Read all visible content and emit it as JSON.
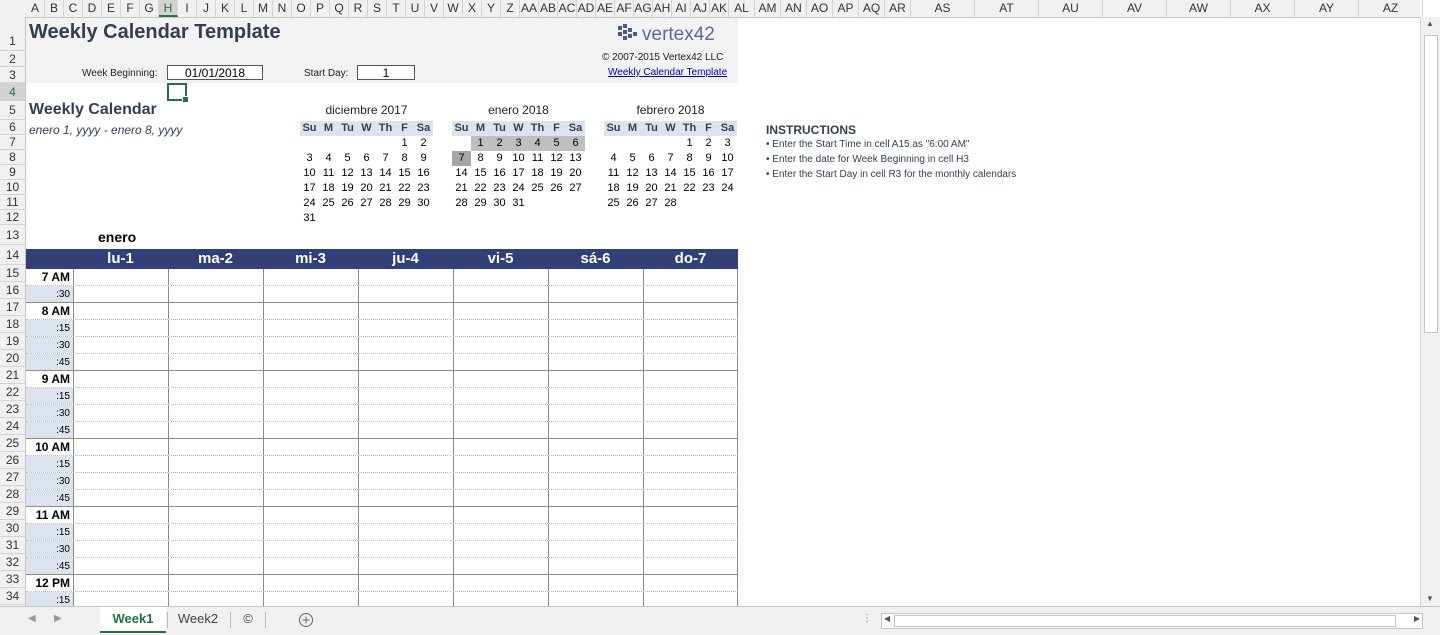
{
  "columns": [
    "A",
    "B",
    "C",
    "D",
    "E",
    "F",
    "G",
    "H",
    "I",
    "J",
    "K",
    "L",
    "M",
    "N",
    "O",
    "P",
    "Q",
    "R",
    "S",
    "T",
    "U",
    "V",
    "W",
    "X",
    "Y",
    "Z",
    "AA",
    "AB",
    "AC",
    "AD",
    "AE",
    "AF",
    "AG",
    "AH",
    "AI",
    "AJ",
    "AK",
    "AL",
    "AM",
    "AN",
    "AO",
    "AP",
    "AQ",
    "AR",
    "AS",
    "AT",
    "AU",
    "AV",
    "AW",
    "AX",
    "AY",
    "AZ"
  ],
  "selected_column": "H",
  "rows": [
    "1",
    "2",
    "3",
    "4",
    "5",
    "6",
    "7",
    "8",
    "9",
    "10",
    "11",
    "12",
    "13",
    "14",
    "15",
    "16",
    "17",
    "18",
    "19",
    "20",
    "21",
    "22",
    "23",
    "24",
    "25",
    "26",
    "27",
    "28",
    "29",
    "30",
    "31",
    "32",
    "33",
    "34"
  ],
  "selected_row": "4",
  "header": {
    "title": "Weekly Calendar Template",
    "logo_text": "vertex42",
    "copyright": "© 2007-2015 Vertex42 LLC",
    "link": "Weekly Calendar Template",
    "week_beginning_label": "Week Beginning:",
    "week_beginning_value": "01/01/2018",
    "start_day_label": "Start Day:",
    "start_day_value": "1"
  },
  "calendar": {
    "heading": "Weekly Calendar",
    "range": "enero 1, yyyy - enero 8, yyyy",
    "month_label": "enero"
  },
  "mini_calendars": [
    {
      "title": "diciembre 2017",
      "days": [
        "Su",
        "M",
        "Tu",
        "W",
        "Th",
        "F",
        "Sa"
      ],
      "weeks": [
        [
          "",
          "",
          "",
          "",
          "",
          "1",
          "2"
        ],
        [
          "3",
          "4",
          "5",
          "6",
          "7",
          "8",
          "9"
        ],
        [
          "10",
          "11",
          "12",
          "13",
          "14",
          "15",
          "16"
        ],
        [
          "17",
          "18",
          "19",
          "20",
          "21",
          "22",
          "23"
        ],
        [
          "24",
          "25",
          "26",
          "27",
          "28",
          "29",
          "30"
        ],
        [
          "31",
          "",
          "",
          "",
          "",
          "",
          ""
        ]
      ]
    },
    {
      "title": "enero 2018",
      "days": [
        "Su",
        "M",
        "Tu",
        "W",
        "Th",
        "F",
        "Sa"
      ],
      "weeks": [
        [
          "",
          "1",
          "2",
          "3",
          "4",
          "5",
          "6"
        ],
        [
          "7",
          "8",
          "9",
          "10",
          "11",
          "12",
          "13"
        ],
        [
          "14",
          "15",
          "16",
          "17",
          "18",
          "19",
          "20"
        ],
        [
          "21",
          "22",
          "23",
          "24",
          "25",
          "26",
          "27"
        ],
        [
          "28",
          "29",
          "30",
          "31",
          "",
          "",
          ""
        ]
      ]
    },
    {
      "title": "febrero 2018",
      "days": [
        "Su",
        "M",
        "Tu",
        "W",
        "Th",
        "F",
        "Sa"
      ],
      "weeks": [
        [
          "",
          "",
          "",
          "",
          "1",
          "2",
          "3"
        ],
        [
          "4",
          "5",
          "6",
          "7",
          "8",
          "9",
          "10"
        ],
        [
          "11",
          "12",
          "13",
          "14",
          "15",
          "16",
          "17"
        ],
        [
          "18",
          "19",
          "20",
          "21",
          "22",
          "23",
          "24"
        ],
        [
          "25",
          "26",
          "27",
          "28",
          "",
          "",
          ""
        ]
      ]
    }
  ],
  "instructions": {
    "heading": "INSTRUCTIONS",
    "items": [
      "• Enter the Start Time in cell A15 as \"6:00 AM\"",
      "• Enter the date for Week Beginning in cell H3",
      "• Enter the Start Day in cell R3 for the monthly calendars"
    ]
  },
  "schedule": {
    "day_headers": [
      "lu-1",
      "ma-2",
      "mi-3",
      "ju-4",
      "vi-5",
      "sá-6",
      "do-7"
    ],
    "time_rows": [
      {
        "label": "7 AM",
        "hour": true
      },
      {
        "label": ":30",
        "hour": false
      },
      {
        "label": "8 AM",
        "hour": true
      },
      {
        "label": ":15",
        "hour": false
      },
      {
        "label": ":30",
        "hour": false
      },
      {
        "label": ":45",
        "hour": false
      },
      {
        "label": "9 AM",
        "hour": true
      },
      {
        "label": ":15",
        "hour": false
      },
      {
        "label": ":30",
        "hour": false
      },
      {
        "label": ":45",
        "hour": false
      },
      {
        "label": "10 AM",
        "hour": true
      },
      {
        "label": ":15",
        "hour": false
      },
      {
        "label": ":30",
        "hour": false
      },
      {
        "label": ":45",
        "hour": false
      },
      {
        "label": "11 AM",
        "hour": true
      },
      {
        "label": ":15",
        "hour": false
      },
      {
        "label": ":30",
        "hour": false
      },
      {
        "label": ":45",
        "hour": false
      },
      {
        "label": "12 PM",
        "hour": true
      },
      {
        "label": ":15",
        "hour": false
      }
    ]
  },
  "sheet_tabs": [
    "Week1",
    "Week2",
    "©"
  ],
  "active_tab": "Week1",
  "add_sheet_icon": "plus-circle-icon",
  "colors": {
    "header_band": "#333f78",
    "time_col": "#dde3ee",
    "accent": "#217346",
    "title": "#333f50"
  }
}
